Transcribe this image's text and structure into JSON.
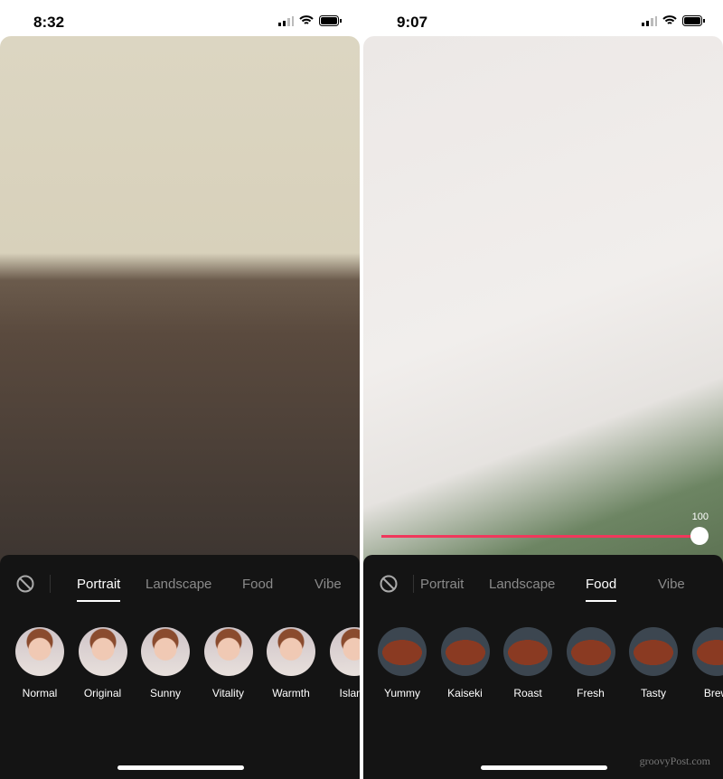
{
  "watermark": "groovyPost.com",
  "colors": {
    "slider_accent": "#f0385c",
    "panel_bg": "#141414"
  },
  "left": {
    "time": "8:32",
    "tabs": [
      "Portrait",
      "Landscape",
      "Food",
      "Vibe"
    ],
    "active_tab": "Portrait",
    "filters": [
      "Normal",
      "Original",
      "Sunny",
      "Vitality",
      "Warmth",
      "Island"
    ]
  },
  "right": {
    "time": "9:07",
    "tabs": [
      "Portrait",
      "Landscape",
      "Food",
      "Vibe"
    ],
    "active_tab": "Food",
    "slider": {
      "value": "100",
      "fraction": 1.0
    },
    "filters": [
      "Yummy",
      "Kaiseki",
      "Roast",
      "Fresh",
      "Tasty",
      "Brew"
    ]
  }
}
